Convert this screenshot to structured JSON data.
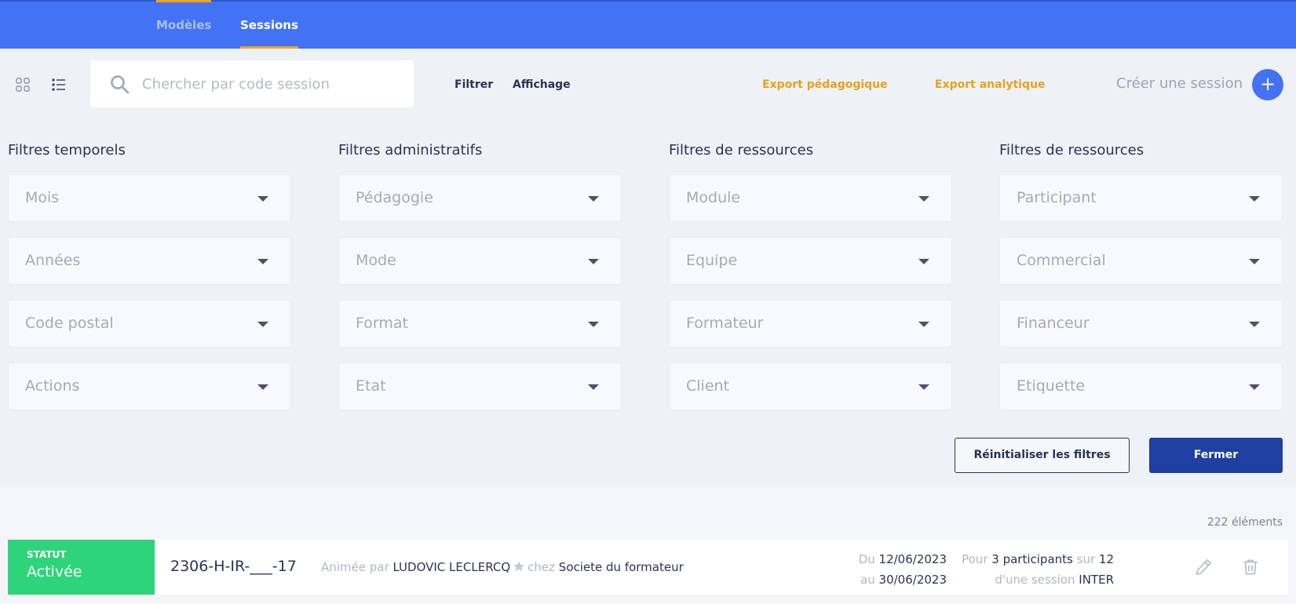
{
  "header": {
    "tabs": [
      {
        "label": "Modèles"
      },
      {
        "label": "Sessions"
      }
    ]
  },
  "toolbar": {
    "search_placeholder": "Chercher par code session",
    "filter_label": "Filtrer",
    "display_label": "Affichage",
    "export_pedagogique": "Export pédagogique",
    "export_analytique": "Export analytique",
    "create_label": "Créer une session",
    "create_symbol": "+"
  },
  "filters": {
    "groups": [
      {
        "title": "Filtres temporels",
        "selects": [
          "Mois",
          "Années",
          "Code postal",
          "Actions"
        ]
      },
      {
        "title": "Filtres administratifs",
        "selects": [
          "Pédagogie",
          "Mode",
          "Format",
          "Etat"
        ]
      },
      {
        "title": "Filtres de ressources",
        "selects": [
          "Module",
          "Equipe",
          "Formateur",
          "Client"
        ]
      },
      {
        "title": "Filtres de ressources",
        "selects": [
          "Participant",
          "Commercial",
          "Financeur",
          "Etiquette"
        ]
      }
    ],
    "reset_label": "Réinitialiser les filtres",
    "close_label": "Fermer"
  },
  "list": {
    "count": "222 éléments",
    "rows": [
      {
        "status_title": "STATUT",
        "status_value": "Activée",
        "code": "2306-H-IR-___-17",
        "animated_by_prefix": "Animée par",
        "trainer": "LUDOVIC LECLERCQ",
        "at_prefix": "chez",
        "company": "Societe du formateur",
        "from_prefix": "Du",
        "start_date": "12/06/2023",
        "to_prefix": "au",
        "end_date": "30/06/2023",
        "for_prefix": "Pour",
        "participants": "3 participants",
        "of_prefix": "sur",
        "capacity": "12",
        "session_prefix": "d'une session",
        "session_type": "INTER"
      }
    ]
  },
  "colors": {
    "header_bg": "#4472f5",
    "tab_accent": "#f0a31f",
    "export_color": "#e6a21a",
    "status_active": "#2ed47a",
    "primary_button": "#1f3fa2"
  }
}
